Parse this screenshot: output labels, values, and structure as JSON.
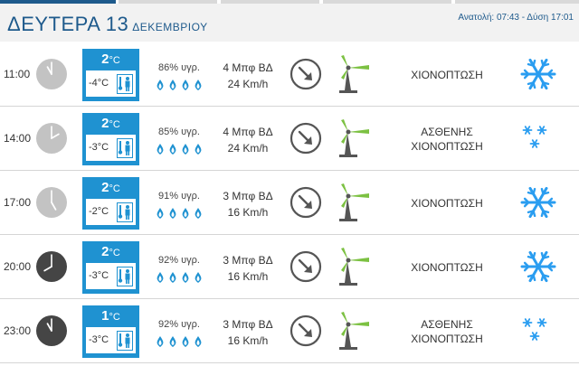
{
  "header": {
    "day": "ΔΕΥΤΕΡΑ 13",
    "month": "ΔΕΚΕΜΒΡΙΟΥ",
    "sun_info": "Ανατολή: 07:43  - Δύση 17:01"
  },
  "colors": {
    "accent": "#1f92d1",
    "title": "#1e5a8c",
    "snow": "#2a9df0",
    "turbine_blade": "#7cc142",
    "clock_day": "#c3c3c3",
    "clock_night": "#454545"
  },
  "rows": [
    {
      "time": "11:00",
      "clock": "day",
      "temp": "2",
      "temp_unit": "°C",
      "feels_like": "-4°C",
      "humidity": "86% υγρ.",
      "drops_filled": 4,
      "wind_force": "4 Μπφ ΒΔ",
      "wind_speed": "24 Km/h",
      "condition_lines": [
        "ΧΙΟΝΟΠΤΩΣΗ"
      ],
      "weather_icon": "heavy-snow-icon"
    },
    {
      "time": "14:00",
      "clock": "day",
      "temp": "2",
      "temp_unit": "°C",
      "feels_like": "-3°C",
      "humidity": "85% υγρ.",
      "drops_filled": 4,
      "wind_force": "4 Μπφ ΒΔ",
      "wind_speed": "24 Km/h",
      "condition_lines": [
        "ΑΣΘΕΝΗΣ",
        "ΧΙΟΝΟΠΤΩΣΗ"
      ],
      "weather_icon": "light-snow-icon"
    },
    {
      "time": "17:00",
      "clock": "day",
      "temp": "2",
      "temp_unit": "°C",
      "feels_like": "-2°C",
      "humidity": "91% υγρ.",
      "drops_filled": 4,
      "wind_force": "3 Μπφ ΒΔ",
      "wind_speed": "16 Km/h",
      "condition_lines": [
        "ΧΙΟΝΟΠΤΩΣΗ"
      ],
      "weather_icon": "heavy-snow-icon"
    },
    {
      "time": "20:00",
      "clock": "night",
      "temp": "2",
      "temp_unit": "°C",
      "feels_like": "-3°C",
      "humidity": "92% υγρ.",
      "drops_filled": 4,
      "wind_force": "3 Μπφ ΒΔ",
      "wind_speed": "16 Km/h",
      "condition_lines": [
        "ΧΙΟΝΟΠΤΩΣΗ"
      ],
      "weather_icon": "heavy-snow-icon"
    },
    {
      "time": "23:00",
      "clock": "night",
      "temp": "1",
      "temp_unit": "°C",
      "feels_like": "-3°C",
      "humidity": "92% υγρ.",
      "drops_filled": 4,
      "wind_force": "3 Μπφ ΒΔ",
      "wind_speed": "16 Km/h",
      "condition_lines": [
        "ΑΣΘΕΝΗΣ",
        "ΧΙΟΝΟΠΤΩΣΗ"
      ],
      "weather_icon": "light-snow-icon"
    }
  ]
}
